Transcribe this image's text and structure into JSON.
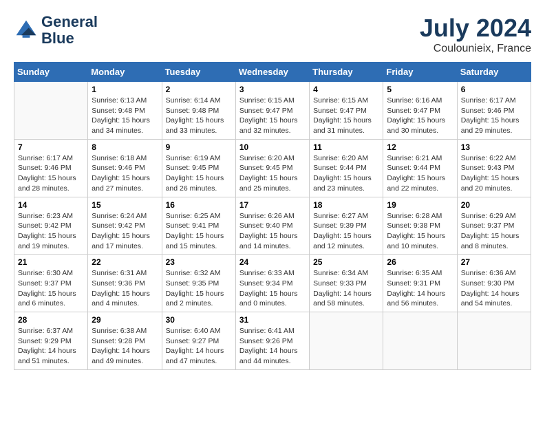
{
  "header": {
    "logo_line1": "General",
    "logo_line2": "Blue",
    "month_title": "July 2024",
    "location": "Coulounieix, France"
  },
  "calendar": {
    "days_of_week": [
      "Sunday",
      "Monday",
      "Tuesday",
      "Wednesday",
      "Thursday",
      "Friday",
      "Saturday"
    ],
    "weeks": [
      [
        {
          "day": "",
          "info": ""
        },
        {
          "day": "1",
          "info": "Sunrise: 6:13 AM\nSunset: 9:48 PM\nDaylight: 15 hours\nand 34 minutes."
        },
        {
          "day": "2",
          "info": "Sunrise: 6:14 AM\nSunset: 9:48 PM\nDaylight: 15 hours\nand 33 minutes."
        },
        {
          "day": "3",
          "info": "Sunrise: 6:15 AM\nSunset: 9:47 PM\nDaylight: 15 hours\nand 32 minutes."
        },
        {
          "day": "4",
          "info": "Sunrise: 6:15 AM\nSunset: 9:47 PM\nDaylight: 15 hours\nand 31 minutes."
        },
        {
          "day": "5",
          "info": "Sunrise: 6:16 AM\nSunset: 9:47 PM\nDaylight: 15 hours\nand 30 minutes."
        },
        {
          "day": "6",
          "info": "Sunrise: 6:17 AM\nSunset: 9:46 PM\nDaylight: 15 hours\nand 29 minutes."
        }
      ],
      [
        {
          "day": "7",
          "info": "Sunrise: 6:17 AM\nSunset: 9:46 PM\nDaylight: 15 hours\nand 28 minutes."
        },
        {
          "day": "8",
          "info": "Sunrise: 6:18 AM\nSunset: 9:46 PM\nDaylight: 15 hours\nand 27 minutes."
        },
        {
          "day": "9",
          "info": "Sunrise: 6:19 AM\nSunset: 9:45 PM\nDaylight: 15 hours\nand 26 minutes."
        },
        {
          "day": "10",
          "info": "Sunrise: 6:20 AM\nSunset: 9:45 PM\nDaylight: 15 hours\nand 25 minutes."
        },
        {
          "day": "11",
          "info": "Sunrise: 6:20 AM\nSunset: 9:44 PM\nDaylight: 15 hours\nand 23 minutes."
        },
        {
          "day": "12",
          "info": "Sunrise: 6:21 AM\nSunset: 9:44 PM\nDaylight: 15 hours\nand 22 minutes."
        },
        {
          "day": "13",
          "info": "Sunrise: 6:22 AM\nSunset: 9:43 PM\nDaylight: 15 hours\nand 20 minutes."
        }
      ],
      [
        {
          "day": "14",
          "info": "Sunrise: 6:23 AM\nSunset: 9:42 PM\nDaylight: 15 hours\nand 19 minutes."
        },
        {
          "day": "15",
          "info": "Sunrise: 6:24 AM\nSunset: 9:42 PM\nDaylight: 15 hours\nand 17 minutes."
        },
        {
          "day": "16",
          "info": "Sunrise: 6:25 AM\nSunset: 9:41 PM\nDaylight: 15 hours\nand 15 minutes."
        },
        {
          "day": "17",
          "info": "Sunrise: 6:26 AM\nSunset: 9:40 PM\nDaylight: 15 hours\nand 14 minutes."
        },
        {
          "day": "18",
          "info": "Sunrise: 6:27 AM\nSunset: 9:39 PM\nDaylight: 15 hours\nand 12 minutes."
        },
        {
          "day": "19",
          "info": "Sunrise: 6:28 AM\nSunset: 9:38 PM\nDaylight: 15 hours\nand 10 minutes."
        },
        {
          "day": "20",
          "info": "Sunrise: 6:29 AM\nSunset: 9:37 PM\nDaylight: 15 hours\nand 8 minutes."
        }
      ],
      [
        {
          "day": "21",
          "info": "Sunrise: 6:30 AM\nSunset: 9:37 PM\nDaylight: 15 hours\nand 6 minutes."
        },
        {
          "day": "22",
          "info": "Sunrise: 6:31 AM\nSunset: 9:36 PM\nDaylight: 15 hours\nand 4 minutes."
        },
        {
          "day": "23",
          "info": "Sunrise: 6:32 AM\nSunset: 9:35 PM\nDaylight: 15 hours\nand 2 minutes."
        },
        {
          "day": "24",
          "info": "Sunrise: 6:33 AM\nSunset: 9:34 PM\nDaylight: 15 hours\nand 0 minutes."
        },
        {
          "day": "25",
          "info": "Sunrise: 6:34 AM\nSunset: 9:33 PM\nDaylight: 14 hours\nand 58 minutes."
        },
        {
          "day": "26",
          "info": "Sunrise: 6:35 AM\nSunset: 9:31 PM\nDaylight: 14 hours\nand 56 minutes."
        },
        {
          "day": "27",
          "info": "Sunrise: 6:36 AM\nSunset: 9:30 PM\nDaylight: 14 hours\nand 54 minutes."
        }
      ],
      [
        {
          "day": "28",
          "info": "Sunrise: 6:37 AM\nSunset: 9:29 PM\nDaylight: 14 hours\nand 51 minutes."
        },
        {
          "day": "29",
          "info": "Sunrise: 6:38 AM\nSunset: 9:28 PM\nDaylight: 14 hours\nand 49 minutes."
        },
        {
          "day": "30",
          "info": "Sunrise: 6:40 AM\nSunset: 9:27 PM\nDaylight: 14 hours\nand 47 minutes."
        },
        {
          "day": "31",
          "info": "Sunrise: 6:41 AM\nSunset: 9:26 PM\nDaylight: 14 hours\nand 44 minutes."
        },
        {
          "day": "",
          "info": ""
        },
        {
          "day": "",
          "info": ""
        },
        {
          "day": "",
          "info": ""
        }
      ]
    ]
  }
}
